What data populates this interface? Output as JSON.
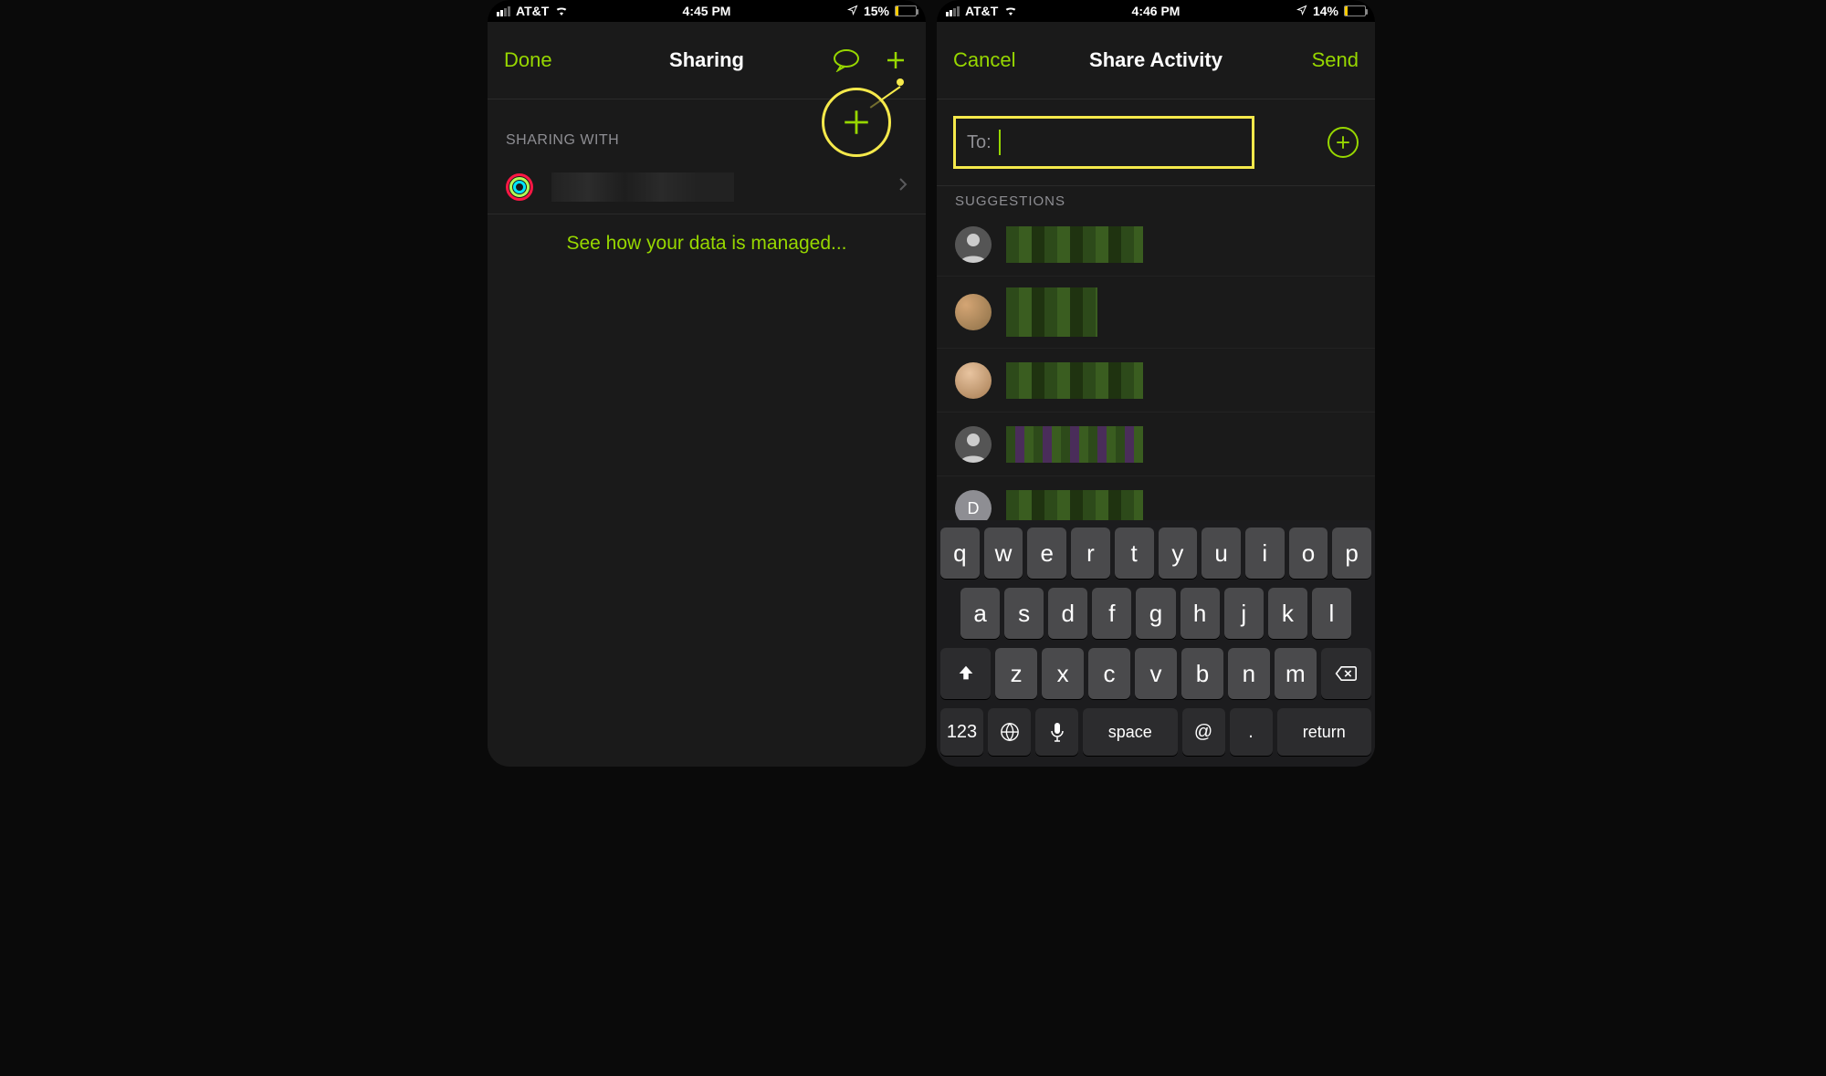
{
  "phone1": {
    "status": {
      "carrier": "AT&T",
      "time": "4:45 PM",
      "battery_pct": "15%",
      "battery_fill_pct": 15
    },
    "nav": {
      "left": "Done",
      "title": "Sharing"
    },
    "section_header": "SHARING WITH",
    "data_managed": "See how your data is managed..."
  },
  "phone2": {
    "status": {
      "carrier": "AT&T",
      "time": "4:46 PM",
      "battery_pct": "14%",
      "battery_fill_pct": 14
    },
    "nav": {
      "left": "Cancel",
      "title": "Share Activity",
      "right": "Send"
    },
    "to_label": "To:",
    "suggestions_header": "SUGGESTIONS",
    "avatar_letter": "D"
  },
  "keyboard": {
    "row1": [
      "q",
      "w",
      "e",
      "r",
      "t",
      "y",
      "u",
      "i",
      "o",
      "p"
    ],
    "row2": [
      "a",
      "s",
      "d",
      "f",
      "g",
      "h",
      "j",
      "k",
      "l"
    ],
    "row3": [
      "z",
      "x",
      "c",
      "v",
      "b",
      "n",
      "m"
    ],
    "numeric": "123",
    "space": "space",
    "at": "@",
    "dot": ".",
    "return": "return"
  }
}
